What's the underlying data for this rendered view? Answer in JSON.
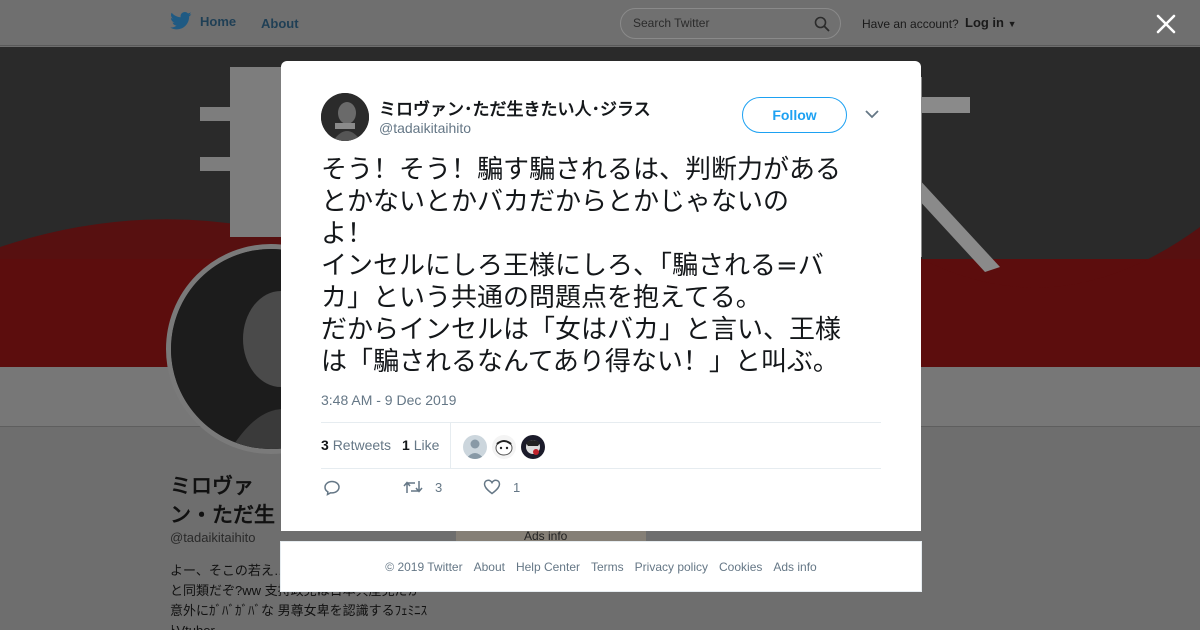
{
  "nav": {
    "home_label": "Home",
    "about_label": "About",
    "search_placeholder": "Search Twitter",
    "account_prompt": "Have an account?",
    "login_label": "Log in"
  },
  "profile_background": {
    "display_name": "ミロヴァン・ただ生きたい人・ジラス",
    "handle": "@tadaikitaihito",
    "bio": "よー、そこの若え… いてくれ お前ら全員俺と同類だぞ?ww 支持政党は日本共産党だが意外にｶﾞﾊﾞｶﾞﾊﾞな 男尊女卑を認識するﾌｪﾐﾆｽﾄVtuber",
    "ads_info": "Ads info"
  },
  "tweet": {
    "display_name": "ミロヴァン･ただ生きたい人･ジラス",
    "handle": "@tadaikitaihito",
    "follow_label": "Follow",
    "text": "そう！そう！騙す騙されるは、判断力がある\nとかないとかバカだからとかじゃないの\nよ！\nインセルにしろ王様にしろ、「騙される=バ\nカ」という共通の問題点を抱えてる。\nだからインセルは「女はバカ」と言い、王様\nは「騙されるなんてあり得ない！」と叫ぶ。",
    "timestamp": "3:48 AM - 9 Dec 2019",
    "retweet_count": "3",
    "retweet_label": "Retweets",
    "like_count": "1",
    "like_label": "Like",
    "action_retweet_count": "3",
    "action_like_count": "1"
  },
  "footer": {
    "copyright": "© 2019 Twitter",
    "about": "About",
    "help": "Help Center",
    "terms": "Terms",
    "privacy": "Privacy policy",
    "cookies": "Cookies",
    "ads": "Ads info"
  },
  "colors": {
    "accent": "#1da1f2",
    "secondary_text": "#657786",
    "overlay": "#6e6e6e"
  },
  "icons": [
    "twitter-bird-icon",
    "search-icon",
    "close-icon",
    "chevron-down-icon",
    "reply-icon",
    "retweet-icon",
    "heart-icon"
  ]
}
